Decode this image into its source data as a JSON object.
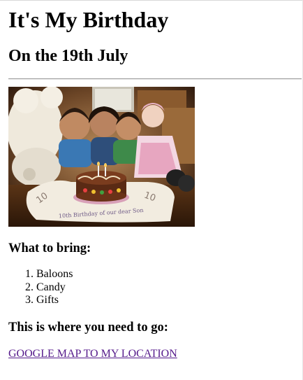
{
  "header": {
    "title": "It's My Birthday",
    "subtitle": "On the 19th July"
  },
  "photo": {
    "description_alt": "",
    "card_text": "10th Birthday of our dear Son",
    "number_left": "10",
    "number_right": "10"
  },
  "bring": {
    "heading": "What to bring:",
    "items": [
      "Baloons",
      "Candy",
      "Gifts"
    ]
  },
  "location": {
    "heading": "This is where you need to go:",
    "link_text": "GOOGLE MAP TO MY LOCATION"
  },
  "colors": {
    "link_visited": "#551a8b",
    "divider": "#9a9a9a"
  }
}
